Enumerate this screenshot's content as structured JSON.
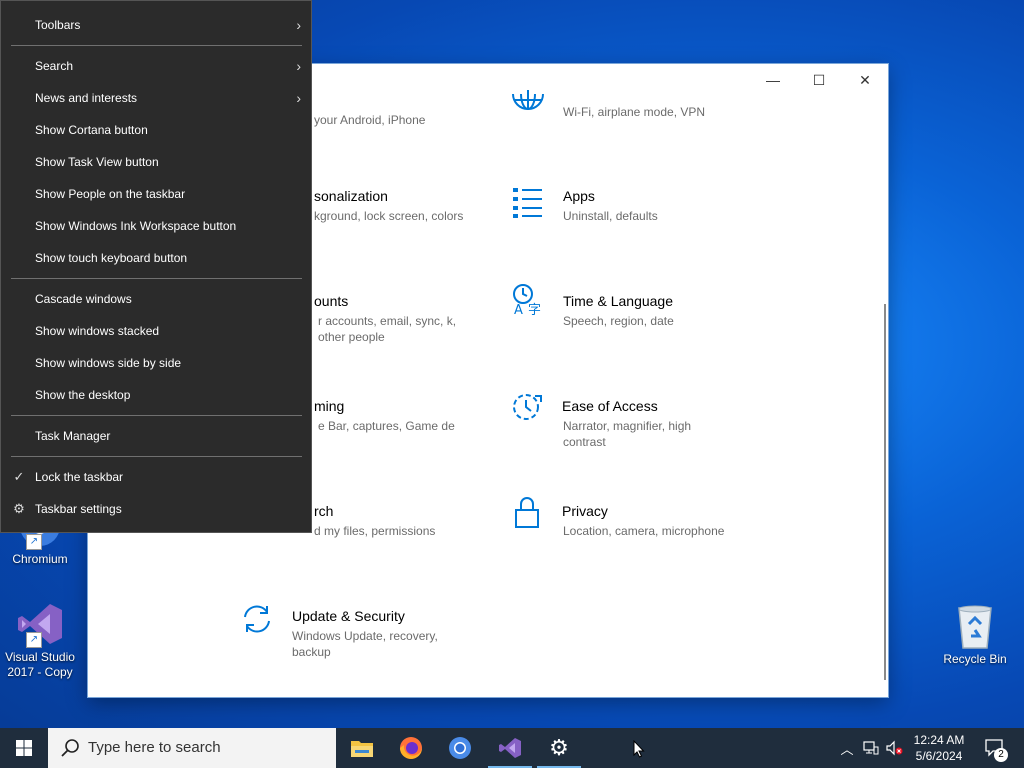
{
  "context_menu": {
    "items": [
      {
        "label": "Toolbars",
        "submenu": true
      },
      {
        "label": "Search",
        "submenu": true
      },
      {
        "label": "News and interests",
        "submenu": true
      },
      {
        "label": "Show Cortana button"
      },
      {
        "label": "Show Task View button"
      },
      {
        "label": "Show People on the taskbar"
      },
      {
        "label": "Show Windows Ink Workspace button"
      },
      {
        "label": "Show touch keyboard button"
      },
      {
        "label": "Cascade windows"
      },
      {
        "label": "Show windows stacked"
      },
      {
        "label": "Show windows side by side"
      },
      {
        "label": "Show the desktop"
      },
      {
        "label": "Task Manager"
      },
      {
        "label": "Lock the taskbar",
        "checked": true
      },
      {
        "label": "Taskbar settings",
        "icon": "gear-icon"
      }
    ]
  },
  "settings": {
    "tiles": [
      {
        "title": "",
        "desc": "your Android, iPhone"
      },
      {
        "title": "",
        "desc": "Wi-Fi, airplane mode, VPN",
        "icon": "network-globe-icon"
      },
      {
        "title": "sonalization",
        "desc": "kground, lock screen, colors"
      },
      {
        "title": "Apps",
        "desc": "Uninstall, defaults",
        "icon": "apps-list-icon"
      },
      {
        "title": "ounts",
        "desc": "r accounts, email, sync, k, other people"
      },
      {
        "title": "Time & Language",
        "desc": "Speech, region, date",
        "icon": "time-language-icon"
      },
      {
        "title": "ming",
        "desc": "e Bar, captures, Game de"
      },
      {
        "title": "Ease of Access",
        "desc": "Narrator, magnifier, high contrast",
        "icon": "ease-of-access-icon"
      },
      {
        "title": "rch",
        "desc": "d my files, permissions"
      },
      {
        "title": "Privacy",
        "desc": "Location, camera, microphone",
        "icon": "lock-icon"
      },
      {
        "title": "Update & Security",
        "desc": "Windows Update, recovery, backup",
        "icon": "sync-arrows-icon"
      }
    ],
    "accent": "#0078d7"
  },
  "desktop": {
    "icons": [
      {
        "label": "Chromium"
      },
      {
        "label": "Visual Studio 2017 - Copy"
      },
      {
        "label": "Recycle Bin"
      }
    ]
  },
  "taskbar": {
    "search_placeholder": "Type here to search",
    "time": "12:24 AM",
    "date": "5/6/2024",
    "notification_count": "2"
  }
}
